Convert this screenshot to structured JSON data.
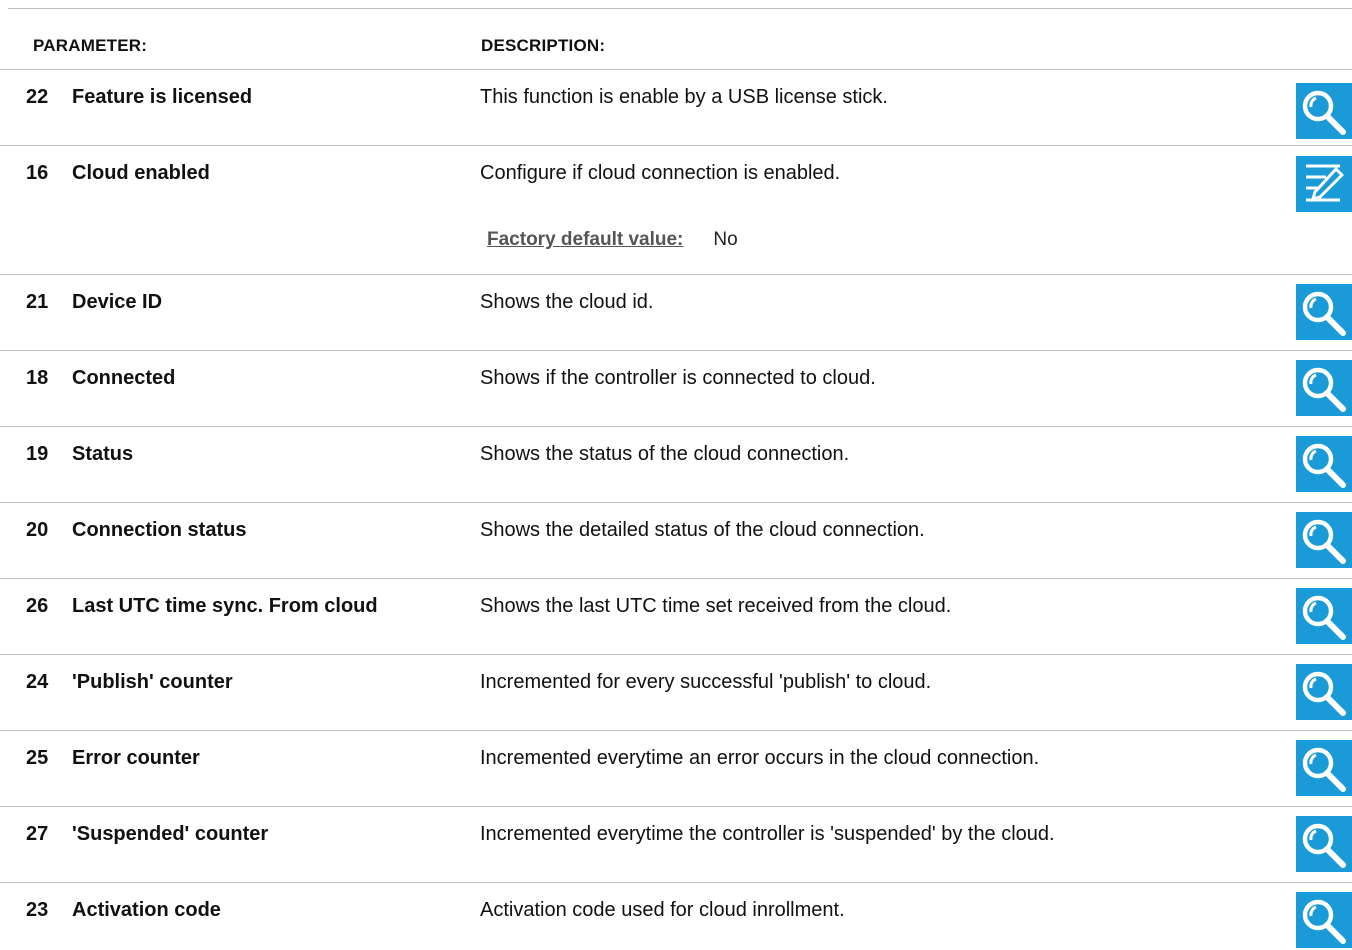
{
  "header": {
    "parameter_label": "PARAMETER:",
    "description_label": "DESCRIPTION:"
  },
  "colors": {
    "icon_background": "#1a9bd7",
    "rule": "#bdbdbd"
  },
  "rows": [
    {
      "number": "22",
      "name": "Feature is licensed",
      "description": "This function is enable by a USB license stick.",
      "icon": "magnifier-icon"
    },
    {
      "number": "16",
      "name": "Cloud enabled",
      "description": "Configure if cloud connection is enabled.",
      "default_label": "Factory default value:",
      "default_value": "No",
      "icon": "edit-icon"
    },
    {
      "number": "21",
      "name": "Device ID",
      "description": "Shows the cloud id.",
      "icon": "magnifier-icon"
    },
    {
      "number": "18",
      "name": "Connected",
      "description": "Shows if the controller is connected to cloud.",
      "icon": "magnifier-icon"
    },
    {
      "number": "19",
      "name": "Status",
      "description": "Shows the status of the cloud connection.",
      "icon": "magnifier-icon"
    },
    {
      "number": "20",
      "name": "Connection status",
      "description": "Shows the detailed status of the cloud connection.",
      "icon": "magnifier-icon"
    },
    {
      "number": "26",
      "name": "Last UTC time sync. From cloud",
      "description": "Shows the last UTC time set received from the cloud.",
      "icon": "magnifier-icon"
    },
    {
      "number": "24",
      "name": "'Publish' counter",
      "description": "Incremented for every successful 'publish' to cloud.",
      "icon": "magnifier-icon"
    },
    {
      "number": "25",
      "name": "Error counter",
      "description": "Incremented everytime an error occurs in the cloud connection.",
      "icon": "magnifier-icon"
    },
    {
      "number": "27",
      "name": "'Suspended' counter",
      "description": "Incremented everytime the controller is 'suspended' by the cloud.",
      "icon": "magnifier-icon"
    },
    {
      "number": "23",
      "name": "Activation code",
      "description": "Activation code used for cloud inrollment.",
      "icon": "magnifier-icon"
    }
  ]
}
